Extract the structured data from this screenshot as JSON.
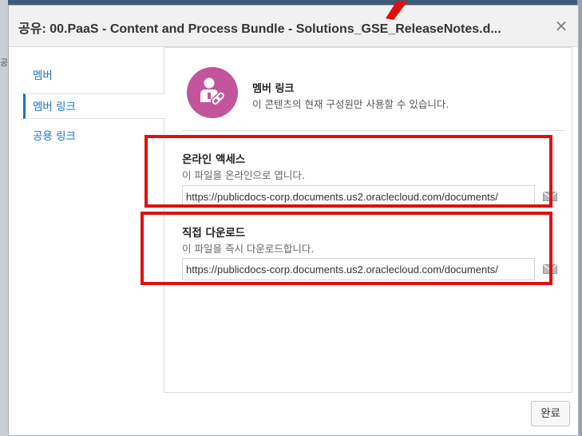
{
  "dialog": {
    "title": "공유: 00.PaaS - Content and Process Bundle - Solutions_GSE_ReleaseNotes.d...",
    "close_label": "×",
    "done_label": "완료"
  },
  "sidebar": {
    "items": [
      {
        "label": "멤버"
      },
      {
        "label": "멤버 링크"
      },
      {
        "label": "공용 링크"
      }
    ]
  },
  "member_link": {
    "title": "멤버 링크",
    "description": "이 콘텐츠의 현재 구성원만 사용할 수 있습니다.",
    "icon": "member-link-icon",
    "icon_color": "#c2549b"
  },
  "online_access": {
    "title": "온라인 액세스",
    "description": "이 파일을 온라인으로 엽니다.",
    "url": "https://publicdocs-corp.documents.us2.oraclecloud.com/documents/"
  },
  "direct_download": {
    "title": "직접 다운로드",
    "description": "이 파일을 즉시 다운로드합니다.",
    "url": "https://publicdocs-corp.documents.us2.oraclecloud.com/documents/"
  },
  "background": {
    "left_char": "공"
  },
  "colors": {
    "highlight": "#e01010",
    "link": "#1a73c9"
  }
}
